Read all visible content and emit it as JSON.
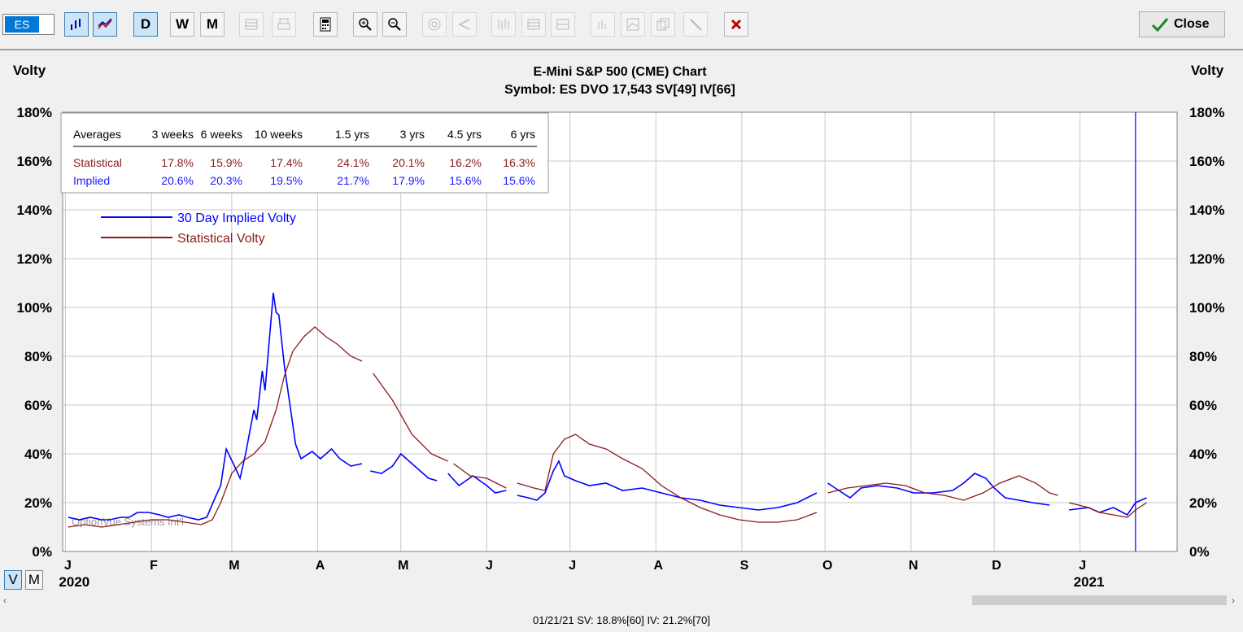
{
  "toolbar": {
    "symbol": "ES",
    "buttons": [
      {
        "name": "bar-chart-icon",
        "state": "on"
      },
      {
        "name": "line-chart-icon",
        "state": "on"
      },
      {
        "name": "daily-button",
        "label": "D",
        "state": "on"
      },
      {
        "name": "weekly-button",
        "label": "W",
        "state": "normal"
      },
      {
        "name": "monthly-button",
        "label": "M",
        "state": "normal"
      },
      {
        "name": "grid-icon",
        "state": "disabled"
      },
      {
        "name": "print-icon",
        "state": "disabled"
      },
      {
        "name": "calculator-icon",
        "state": "normal"
      },
      {
        "name": "zoom-in-icon",
        "state": "normal"
      },
      {
        "name": "zoom-out-icon",
        "state": "normal"
      },
      {
        "name": "target-icon",
        "state": "disabled"
      },
      {
        "name": "angle-icon",
        "state": "disabled"
      },
      {
        "name": "candles-icon",
        "state": "disabled"
      },
      {
        "name": "table-icon",
        "state": "disabled"
      },
      {
        "name": "table-alt-icon",
        "state": "disabled"
      },
      {
        "name": "histogram-icon",
        "state": "disabled"
      },
      {
        "name": "chart-box-icon",
        "state": "disabled"
      },
      {
        "name": "copy-icon",
        "state": "disabled"
      },
      {
        "name": "pencil-icon",
        "state": "disabled"
      },
      {
        "name": "delete-icon",
        "state": "normal"
      }
    ],
    "close_label": "Close"
  },
  "view_toggle": {
    "v": "V",
    "m": "M"
  },
  "status_bar": "01/21/21  SV: 18.8%[60]  IV: 21.2%[70]",
  "chart_data": {
    "type": "line",
    "title": "E-Mini S&P 500 (CME) Chart",
    "subtitle": "Symbol: ES  DVO 17,543  SV[49]  IV[66]",
    "ylabel": "Volty",
    "ylim": [
      0,
      180
    ],
    "y_ticks": [
      "0%",
      "20%",
      "40%",
      "60%",
      "80%",
      "100%",
      "120%",
      "140%",
      "160%",
      "180%"
    ],
    "x_ticks": [
      {
        "label": "J",
        "date": "2020-01-01"
      },
      {
        "label": "F",
        "date": "2020-02-01"
      },
      {
        "label": "M",
        "date": "2020-03-01"
      },
      {
        "label": "A",
        "date": "2020-04-01"
      },
      {
        "label": "M",
        "date": "2020-05-01"
      },
      {
        "label": "J",
        "date": "2020-06-01"
      },
      {
        "label": "J",
        "date": "2020-07-01"
      },
      {
        "label": "A",
        "date": "2020-08-01"
      },
      {
        "label": "S",
        "date": "2020-09-01"
      },
      {
        "label": "O",
        "date": "2020-10-01"
      },
      {
        "label": "N",
        "date": "2020-11-01"
      },
      {
        "label": "D",
        "date": "2020-12-01"
      },
      {
        "label": "J",
        "date": "2021-01-01"
      }
    ],
    "year_labels": [
      {
        "label": "2020",
        "date": "2020-01-01"
      },
      {
        "label": "2021",
        "date": "2021-01-01"
      }
    ],
    "xlim": [
      "2019-12-31",
      "2021-02-05"
    ],
    "cursor_date": "2021-01-21",
    "grid": true,
    "watermark": "OptionVue Systems Int'l",
    "legend_position": "top-left",
    "averages_table": {
      "headers": [
        "Averages",
        "3 weeks",
        "6 weeks",
        "10 weeks",
        "1.5 yrs",
        "3 yrs",
        "4.5 yrs",
        "6 yrs"
      ],
      "rows": [
        {
          "label": "Statistical",
          "values": [
            "17.8%",
            "15.9%",
            "17.4%",
            "24.1%",
            "20.1%",
            "16.2%",
            "16.3%"
          ],
          "color": "#8b1a1a"
        },
        {
          "label": "Implied",
          "values": [
            "20.6%",
            "20.3%",
            "19.5%",
            "21.7%",
            "17.9%",
            "15.6%",
            "15.6%"
          ],
          "color": "#1a1aff"
        }
      ]
    },
    "series": [
      {
        "name": "30 Day Implied Volty",
        "color": "#0000ff",
        "points": [
          [
            "2020-01-02",
            14
          ],
          [
            "2020-01-06",
            13
          ],
          [
            "2020-01-10",
            14
          ],
          [
            "2020-01-14",
            13
          ],
          [
            "2020-01-17",
            13
          ],
          [
            "2020-01-21",
            14
          ],
          [
            "2020-01-24",
            14
          ],
          [
            "2020-01-27",
            16
          ],
          [
            "2020-01-31",
            16
          ],
          [
            "2020-02-04",
            15
          ],
          [
            "2020-02-07",
            14
          ],
          [
            "2020-02-11",
            15
          ],
          [
            "2020-02-14",
            14
          ],
          [
            "2020-02-18",
            13
          ],
          [
            "2020-02-21",
            14
          ],
          [
            "2020-02-24",
            22
          ],
          [
            "2020-02-26",
            27
          ],
          [
            "2020-02-28",
            42
          ],
          [
            "2020-03-02",
            35
          ],
          [
            "2020-03-04",
            30
          ],
          [
            "2020-03-06",
            40
          ],
          [
            "2020-03-09",
            58
          ],
          [
            "2020-03-10",
            54
          ],
          [
            "2020-03-12",
            74
          ],
          [
            "2020-03-13",
            66
          ],
          [
            "2020-03-16",
            106
          ],
          [
            "2020-03-17",
            98
          ],
          [
            "2020-03-18",
            97
          ],
          [
            "2020-03-20",
            76
          ],
          [
            "2020-03-23",
            52
          ],
          [
            "2020-03-24",
            44
          ],
          [
            "2020-03-26",
            38
          ],
          [
            "2020-03-30",
            41
          ],
          [
            "2020-04-02",
            38
          ],
          [
            "2020-04-06",
            42
          ],
          [
            "2020-04-09",
            38
          ],
          [
            "2020-04-13",
            35
          ],
          [
            "2020-04-17",
            36
          ]
        ],
        "segments": [
          [
            [
              "2020-04-20",
              33
            ],
            [
              "2020-04-24",
              32
            ],
            [
              "2020-04-28",
              35
            ],
            [
              "2020-05-01",
              40
            ],
            [
              "2020-05-05",
              36
            ],
            [
              "2020-05-08",
              33
            ],
            [
              "2020-05-11",
              30
            ],
            [
              "2020-05-14",
              29
            ]
          ],
          [
            [
              "2020-05-18",
              32
            ],
            [
              "2020-05-22",
              27
            ],
            [
              "2020-05-27",
              31
            ],
            [
              "2020-06-01",
              27
            ],
            [
              "2020-06-04",
              24
            ],
            [
              "2020-06-08",
              25
            ]
          ],
          [
            [
              "2020-06-12",
              23
            ],
            [
              "2020-06-16",
              22
            ],
            [
              "2020-06-19",
              21
            ],
            [
              "2020-06-22",
              24
            ],
            [
              "2020-06-25",
              33
            ],
            [
              "2020-06-27",
              37
            ],
            [
              "2020-06-29",
              31
            ],
            [
              "2020-07-03",
              29
            ],
            [
              "2020-07-08",
              27
            ],
            [
              "2020-07-14",
              28
            ],
            [
              "2020-07-20",
              25
            ],
            [
              "2020-07-27",
              26
            ],
            [
              "2020-08-03",
              24
            ],
            [
              "2020-08-10",
              22
            ],
            [
              "2020-08-17",
              21
            ],
            [
              "2020-08-24",
              19
            ],
            [
              "2020-08-31",
              18
            ],
            [
              "2020-09-07",
              17
            ],
            [
              "2020-09-14",
              18
            ],
            [
              "2020-09-21",
              20
            ],
            [
              "2020-09-28",
              24
            ]
          ],
          [
            [
              "2020-10-02",
              28
            ],
            [
              "2020-10-06",
              25
            ],
            [
              "2020-10-10",
              22
            ],
            [
              "2020-10-14",
              26
            ],
            [
              "2020-10-20",
              27
            ],
            [
              "2020-10-27",
              26
            ],
            [
              "2020-11-02",
              24
            ],
            [
              "2020-11-09",
              24
            ],
            [
              "2020-11-16",
              25
            ],
            [
              "2020-11-20",
              28
            ],
            [
              "2020-11-24",
              32
            ],
            [
              "2020-11-28",
              30
            ],
            [
              "2020-12-01",
              26
            ],
            [
              "2020-12-05",
              22
            ],
            [
              "2020-12-10",
              21
            ],
            [
              "2020-12-15",
              20
            ],
            [
              "2020-12-21",
              19
            ]
          ],
          [
            [
              "2020-12-28",
              17
            ],
            [
              "2021-01-04",
              18
            ],
            [
              "2021-01-08",
              16
            ],
            [
              "2021-01-13",
              18
            ],
            [
              "2021-01-18",
              15
            ],
            [
              "2021-01-21",
              20
            ],
            [
              "2021-01-25",
              22
            ]
          ]
        ]
      },
      {
        "name": "Statistical Volty",
        "color": "#8b1a1a",
        "points": [
          [
            "2020-01-02",
            10
          ],
          [
            "2020-01-08",
            11
          ],
          [
            "2020-01-14",
            10
          ],
          [
            "2020-01-20",
            11
          ],
          [
            "2020-01-26",
            12
          ],
          [
            "2020-02-01",
            13
          ],
          [
            "2020-02-07",
            13
          ],
          [
            "2020-02-13",
            12
          ],
          [
            "2020-02-19",
            11
          ],
          [
            "2020-02-23",
            13
          ],
          [
            "2020-02-26",
            20
          ],
          [
            "2020-03-01",
            32
          ],
          [
            "2020-03-05",
            37
          ],
          [
            "2020-03-09",
            40
          ],
          [
            "2020-03-13",
            45
          ],
          [
            "2020-03-17",
            58
          ],
          [
            "2020-03-20",
            72
          ],
          [
            "2020-03-23",
            82
          ],
          [
            "2020-03-27",
            88
          ],
          [
            "2020-03-31",
            92
          ],
          [
            "2020-04-04",
            88
          ],
          [
            "2020-04-08",
            85
          ],
          [
            "2020-04-13",
            80
          ],
          [
            "2020-04-17",
            78
          ]
        ],
        "segments": [
          [
            [
              "2020-04-21",
              73
            ],
            [
              "2020-04-28",
              62
            ],
            [
              "2020-05-05",
              48
            ],
            [
              "2020-05-12",
              40
            ],
            [
              "2020-05-18",
              37
            ]
          ],
          [
            [
              "2020-05-20",
              36
            ],
            [
              "2020-05-26",
              31
            ],
            [
              "2020-06-01",
              30
            ],
            [
              "2020-06-08",
              26
            ]
          ],
          [
            [
              "2020-06-12",
              28
            ],
            [
              "2020-06-18",
              26
            ],
            [
              "2020-06-22",
              25
            ],
            [
              "2020-06-25",
              40
            ],
            [
              "2020-06-29",
              46
            ],
            [
              "2020-07-03",
              48
            ],
            [
              "2020-07-08",
              44
            ],
            [
              "2020-07-14",
              42
            ],
            [
              "2020-07-20",
              38
            ],
            [
              "2020-07-27",
              34
            ],
            [
              "2020-08-03",
              27
            ],
            [
              "2020-08-10",
              22
            ],
            [
              "2020-08-17",
              18
            ],
            [
              "2020-08-24",
              15
            ],
            [
              "2020-08-31",
              13
            ],
            [
              "2020-09-07",
              12
            ],
            [
              "2020-09-14",
              12
            ],
            [
              "2020-09-21",
              13
            ],
            [
              "2020-09-28",
              16
            ]
          ],
          [
            [
              "2020-10-02",
              24
            ],
            [
              "2020-10-09",
              26
            ],
            [
              "2020-10-16",
              27
            ],
            [
              "2020-10-23",
              28
            ],
            [
              "2020-10-30",
              27
            ],
            [
              "2020-11-06",
              24
            ],
            [
              "2020-11-13",
              23
            ],
            [
              "2020-11-20",
              21
            ],
            [
              "2020-11-27",
              24
            ],
            [
              "2020-12-03",
              28
            ],
            [
              "2020-12-10",
              31
            ],
            [
              "2020-12-16",
              28
            ],
            [
              "2020-12-21",
              24
            ],
            [
              "2020-12-24",
              23
            ]
          ],
          [
            [
              "2020-12-28",
              20
            ],
            [
              "2021-01-04",
              18
            ],
            [
              "2021-01-08",
              16
            ],
            [
              "2021-01-13",
              15
            ],
            [
              "2021-01-18",
              14
            ],
            [
              "2021-01-21",
              17
            ],
            [
              "2021-01-25",
              20
            ]
          ]
        ]
      }
    ]
  }
}
